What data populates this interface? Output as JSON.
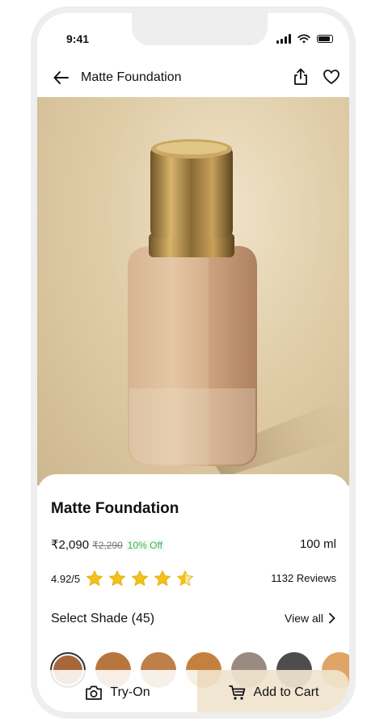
{
  "status_bar": {
    "time": "9:41"
  },
  "app_bar": {
    "title": "Matte Foundation"
  },
  "product": {
    "name": "Matte Foundation",
    "price": "₹2,090",
    "mrp": "₹2,290",
    "discount": "10% Off",
    "volume": "100 ml",
    "rating_text": "4.92/5",
    "rating_value": 4.92,
    "reviews": "1132 Reviews"
  },
  "shades": {
    "title": "Select Shade (45)",
    "view_all_label": "View all",
    "colors": [
      "#a8673a",
      "#b8763f",
      "#bd8049",
      "#c4813e",
      "#9a8a82",
      "#4d4d4d",
      "#e0a566"
    ],
    "selected_index": 0
  },
  "actions": {
    "tryon_label": "Try-On",
    "cart_label": "Add to Cart"
  }
}
